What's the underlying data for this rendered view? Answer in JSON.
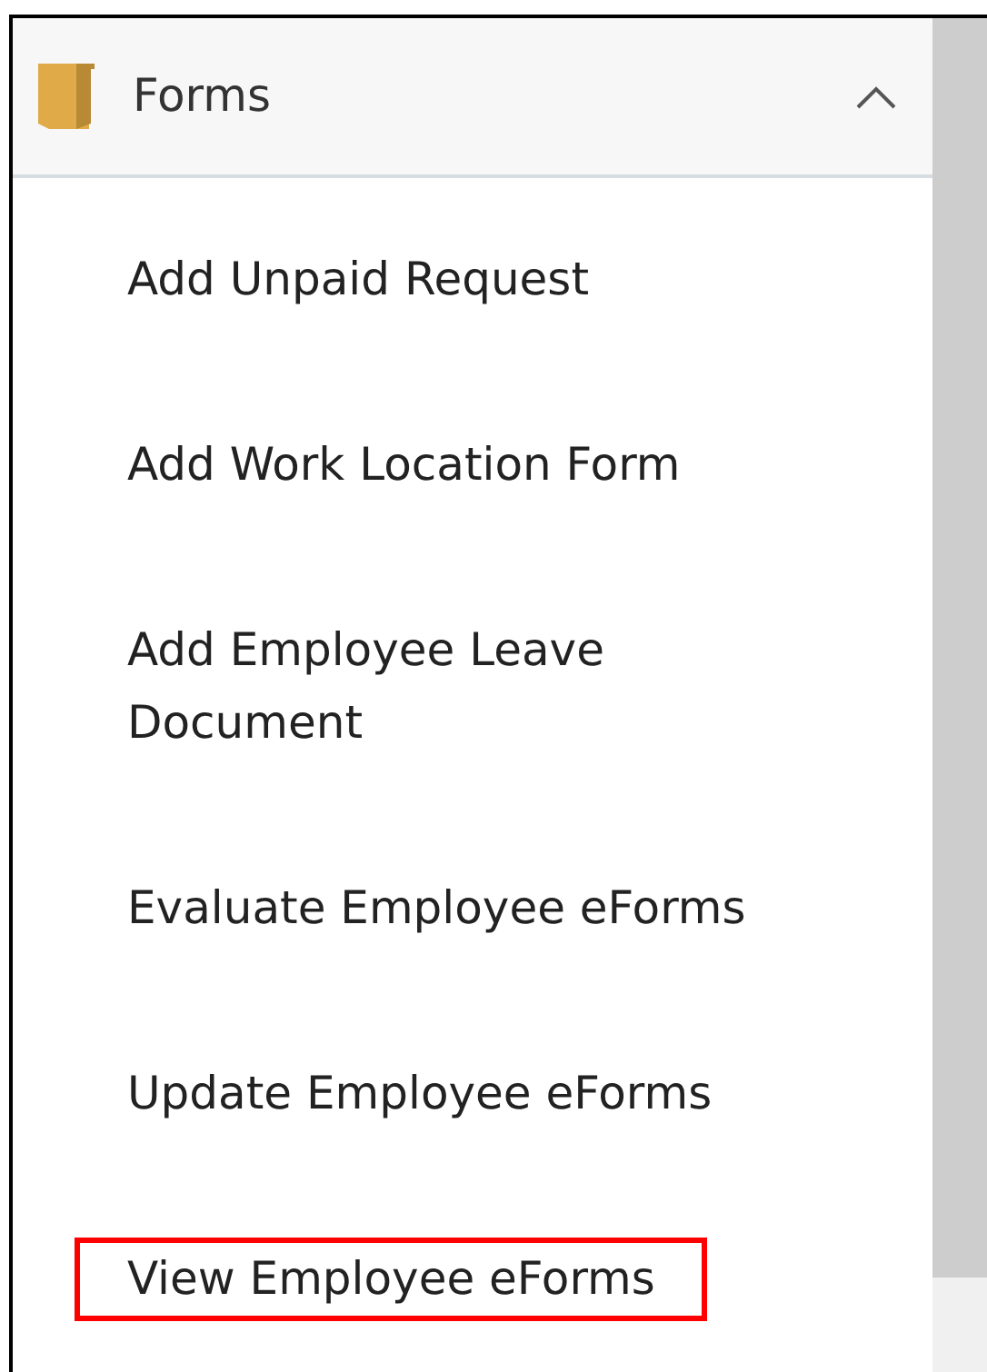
{
  "section": {
    "title": "Forms",
    "expanded": true
  },
  "items": [
    {
      "label": "Add Unpaid Request",
      "highlighted": false
    },
    {
      "label": "Add Work Location Form",
      "highlighted": false
    },
    {
      "label": "Add Employee Leave Document",
      "highlighted": false
    },
    {
      "label": "Evaluate Employee eForms",
      "highlighted": false
    },
    {
      "label": "Update Employee eForms",
      "highlighted": false
    },
    {
      "label": "View Employee eForms",
      "highlighted": true
    }
  ]
}
